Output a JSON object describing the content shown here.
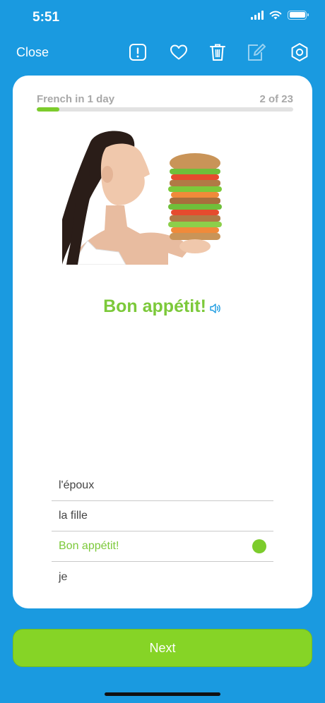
{
  "status": {
    "time": "5:51"
  },
  "toolbar": {
    "close_label": "Close",
    "icons": [
      "report-icon",
      "heart-icon",
      "trash-icon",
      "edit-icon",
      "settings-icon"
    ]
  },
  "lesson": {
    "course_title": "French in 1 day",
    "progress_text": "2 of 23",
    "progress_fraction": 0.087,
    "phrase": "Bon appétit!",
    "image_alt": "woman-with-giant-sandwich"
  },
  "options": [
    {
      "label": "l'époux",
      "selected": false
    },
    {
      "label": "la fille",
      "selected": false
    },
    {
      "label": "Bon appétit!",
      "selected": true
    },
    {
      "label": "je",
      "selected": false
    }
  ],
  "next_label": "Next",
  "colors": {
    "background": "#1a9ae0",
    "accent_green": "#7cc93a",
    "button_green": "#86d426"
  }
}
